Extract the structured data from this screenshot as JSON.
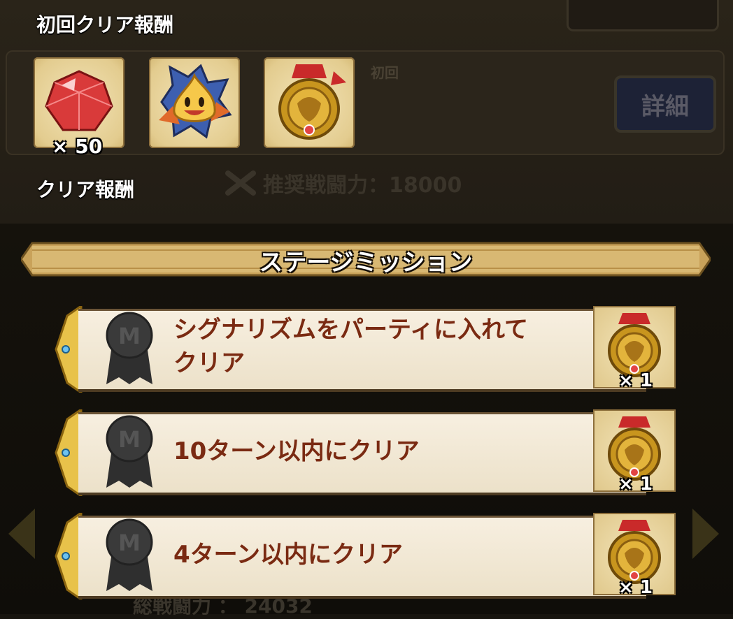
{
  "first_clear": {
    "label": "初回クリア報酬",
    "rewards": [
      {
        "icon": "red-gem-icon",
        "qty": "× 50"
      },
      {
        "icon": "slime-badge-icon",
        "qty": ""
      },
      {
        "icon": "gold-medal-icon",
        "qty": ""
      }
    ]
  },
  "clear_reward": {
    "label": "クリア報酬"
  },
  "background": {
    "detail_button": "詳細",
    "recommended_power": "推奨戦闘力：18000",
    "total_power": "総戦闘力 ： 24032",
    "first_tag": "初回"
  },
  "stage_mission": {
    "title": "ステージミッション",
    "missions": [
      {
        "line1": "シグナリズムをパーティに入れて",
        "line2": "クリア",
        "reward_icon": "gold-medal-icon",
        "reward_qty": "× 1"
      },
      {
        "line1": "10ターン以内にクリア",
        "line2": "",
        "reward_icon": "gold-medal-icon",
        "reward_qty": "× 1"
      },
      {
        "line1": "4ターン以内にクリア",
        "line2": "",
        "reward_icon": "gold-medal-icon",
        "reward_qty": "× 1"
      }
    ]
  },
  "colors": {
    "mission_text": "#7a2a12",
    "banner_gold": "#d8b25a",
    "scroll_bg": "#f3e9d6"
  }
}
